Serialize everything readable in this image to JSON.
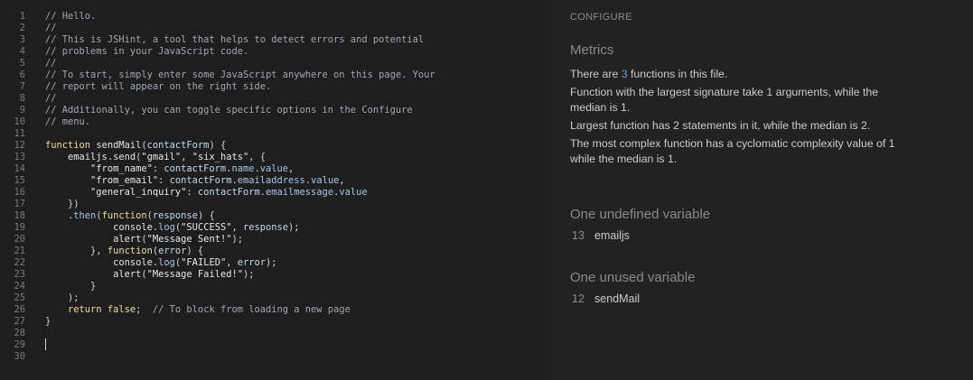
{
  "editor": {
    "lines": [
      {
        "n": "1",
        "tokens": [
          {
            "c": "t-comment",
            "t": "// Hello."
          }
        ]
      },
      {
        "n": "2",
        "tokens": [
          {
            "c": "t-comment",
            "t": "//"
          }
        ]
      },
      {
        "n": "3",
        "tokens": [
          {
            "c": "t-comment",
            "t": "// This is JSHint, a tool that helps to detect errors and potential"
          }
        ]
      },
      {
        "n": "4",
        "tokens": [
          {
            "c": "t-comment",
            "t": "// problems in your JavaScript code."
          }
        ]
      },
      {
        "n": "5",
        "tokens": [
          {
            "c": "t-comment",
            "t": "//"
          }
        ]
      },
      {
        "n": "6",
        "tokens": [
          {
            "c": "t-comment",
            "t": "// To start, simply enter some JavaScript anywhere on this page. Your"
          }
        ]
      },
      {
        "n": "7",
        "tokens": [
          {
            "c": "t-comment",
            "t": "// report will appear on the right side."
          }
        ]
      },
      {
        "n": "8",
        "tokens": [
          {
            "c": "t-comment",
            "t": "//"
          }
        ]
      },
      {
        "n": "9",
        "tokens": [
          {
            "c": "t-comment",
            "t": "// Additionally, you can toggle specific options in the Configure"
          }
        ]
      },
      {
        "n": "10",
        "tokens": [
          {
            "c": "t-comment",
            "t": "// menu."
          }
        ]
      },
      {
        "n": "11",
        "tokens": []
      },
      {
        "n": "12",
        "tokens": [
          {
            "c": "t-kw",
            "t": "function "
          },
          {
            "c": "t-fn",
            "t": "sendMail"
          },
          {
            "c": "t-punc",
            "t": "("
          },
          {
            "c": "t-var",
            "t": "contactForm"
          },
          {
            "c": "t-punc",
            "t": ") {"
          }
        ]
      },
      {
        "n": "13",
        "tokens": [
          {
            "c": "t-fn",
            "t": "    emailjs"
          },
          {
            "c": "t-punc",
            "t": "."
          },
          {
            "c": "t-fn",
            "t": "send"
          },
          {
            "c": "t-punc",
            "t": "("
          },
          {
            "c": "t-str",
            "t": "\"gmail\""
          },
          {
            "c": "t-punc",
            "t": ", "
          },
          {
            "c": "t-str",
            "t": "\"six_hats\""
          },
          {
            "c": "t-punc",
            "t": ", {"
          }
        ]
      },
      {
        "n": "14",
        "tokens": [
          {
            "c": "t-str",
            "t": "        \"from_name\""
          },
          {
            "c": "t-punc",
            "t": ": "
          },
          {
            "c": "t-var",
            "t": "contactForm"
          },
          {
            "c": "t-punc",
            "t": "."
          },
          {
            "c": "t-prop",
            "t": "name"
          },
          {
            "c": "t-punc",
            "t": "."
          },
          {
            "c": "t-prop",
            "t": "value"
          },
          {
            "c": "t-punc",
            "t": ","
          }
        ]
      },
      {
        "n": "15",
        "tokens": [
          {
            "c": "t-str",
            "t": "        \"from_email\""
          },
          {
            "c": "t-punc",
            "t": ": "
          },
          {
            "c": "t-var",
            "t": "contactForm"
          },
          {
            "c": "t-punc",
            "t": "."
          },
          {
            "c": "t-prop",
            "t": "emailaddress"
          },
          {
            "c": "t-punc",
            "t": "."
          },
          {
            "c": "t-prop",
            "t": "value"
          },
          {
            "c": "t-punc",
            "t": ","
          }
        ]
      },
      {
        "n": "16",
        "tokens": [
          {
            "c": "t-str",
            "t": "        \"general_inquiry\""
          },
          {
            "c": "t-punc",
            "t": ": "
          },
          {
            "c": "t-var",
            "t": "contactForm"
          },
          {
            "c": "t-punc",
            "t": "."
          },
          {
            "c": "t-prop",
            "t": "emailmessage"
          },
          {
            "c": "t-punc",
            "t": "."
          },
          {
            "c": "t-prop",
            "t": "value"
          }
        ]
      },
      {
        "n": "17",
        "tokens": [
          {
            "c": "t-punc",
            "t": "    })"
          }
        ]
      },
      {
        "n": "18",
        "tokens": [
          {
            "c": "t-punc",
            "t": "    ."
          },
          {
            "c": "t-prop",
            "t": "then"
          },
          {
            "c": "t-punc",
            "t": "("
          },
          {
            "c": "t-kw",
            "t": "function"
          },
          {
            "c": "t-punc",
            "t": "("
          },
          {
            "c": "t-var",
            "t": "response"
          },
          {
            "c": "t-punc",
            "t": ") {"
          }
        ]
      },
      {
        "n": "19",
        "tokens": [
          {
            "c": "t-fn",
            "t": "            console"
          },
          {
            "c": "t-punc",
            "t": "."
          },
          {
            "c": "t-prop",
            "t": "log"
          },
          {
            "c": "t-punc",
            "t": "("
          },
          {
            "c": "t-str",
            "t": "\"SUCCESS\""
          },
          {
            "c": "t-punc",
            "t": ", "
          },
          {
            "c": "t-var",
            "t": "response"
          },
          {
            "c": "t-punc",
            "t": ");"
          }
        ]
      },
      {
        "n": "20",
        "tokens": [
          {
            "c": "t-fn",
            "t": "            alert"
          },
          {
            "c": "t-punc",
            "t": "("
          },
          {
            "c": "t-str",
            "t": "\"Message Sent!\""
          },
          {
            "c": "t-punc",
            "t": ");"
          }
        ]
      },
      {
        "n": "21",
        "tokens": [
          {
            "c": "t-punc",
            "t": "        }, "
          },
          {
            "c": "t-kw",
            "t": "function"
          },
          {
            "c": "t-punc",
            "t": "("
          },
          {
            "c": "t-var",
            "t": "error"
          },
          {
            "c": "t-punc",
            "t": ") {"
          }
        ]
      },
      {
        "n": "22",
        "tokens": [
          {
            "c": "t-fn",
            "t": "            console"
          },
          {
            "c": "t-punc",
            "t": "."
          },
          {
            "c": "t-prop",
            "t": "log"
          },
          {
            "c": "t-punc",
            "t": "("
          },
          {
            "c": "t-str",
            "t": "\"FAILED\""
          },
          {
            "c": "t-punc",
            "t": ", "
          },
          {
            "c": "t-var",
            "t": "error"
          },
          {
            "c": "t-punc",
            "t": ");"
          }
        ]
      },
      {
        "n": "23",
        "tokens": [
          {
            "c": "t-fn",
            "t": "            alert"
          },
          {
            "c": "t-punc",
            "t": "("
          },
          {
            "c": "t-str",
            "t": "\"Message Failed!\""
          },
          {
            "c": "t-punc",
            "t": ");"
          }
        ]
      },
      {
        "n": "24",
        "tokens": [
          {
            "c": "t-punc",
            "t": "        }"
          }
        ]
      },
      {
        "n": "25",
        "tokens": [
          {
            "c": "t-punc",
            "t": "    );"
          }
        ]
      },
      {
        "n": "26",
        "tokens": [
          {
            "c": "t-kw",
            "t": "    return "
          },
          {
            "c": "t-kw",
            "t": "false"
          },
          {
            "c": "t-punc",
            "t": ";  "
          },
          {
            "c": "t-comment",
            "t": "// To block from loading a new page"
          }
        ]
      },
      {
        "n": "27",
        "tokens": [
          {
            "c": "t-punc",
            "t": "}"
          }
        ]
      },
      {
        "n": "28",
        "tokens": []
      },
      {
        "n": "29",
        "tokens": []
      },
      {
        "n": "30",
        "tokens": []
      }
    ]
  },
  "report": {
    "configure_label": "CONFIGURE",
    "metrics_heading": "Metrics",
    "m1_pre": "There are ",
    "m1_num": "3",
    "m1_post": " functions in this file.",
    "m2_pre": "Function with the largest signature take ",
    "m2_num": "1",
    "m2_mid": " arguments, while the median is ",
    "m2_num2": "1",
    "m2_post": ".",
    "m3_pre": "Largest function has ",
    "m3_num": "2",
    "m3_mid": " statements in it, while the median is ",
    "m3_num2": "2",
    "m3_post": ".",
    "m4_pre": "The most complex function has a cyclomatic complexity value of ",
    "m4_num": "1",
    "m4_mid": " while the median is ",
    "m4_num2": "1",
    "m4_post": ".",
    "undefined_heading": "One undefined variable",
    "undefined_line": "13",
    "undefined_name": "emailjs",
    "unused_heading": "One unused variable",
    "unused_line": "12",
    "unused_name": "sendMail"
  }
}
